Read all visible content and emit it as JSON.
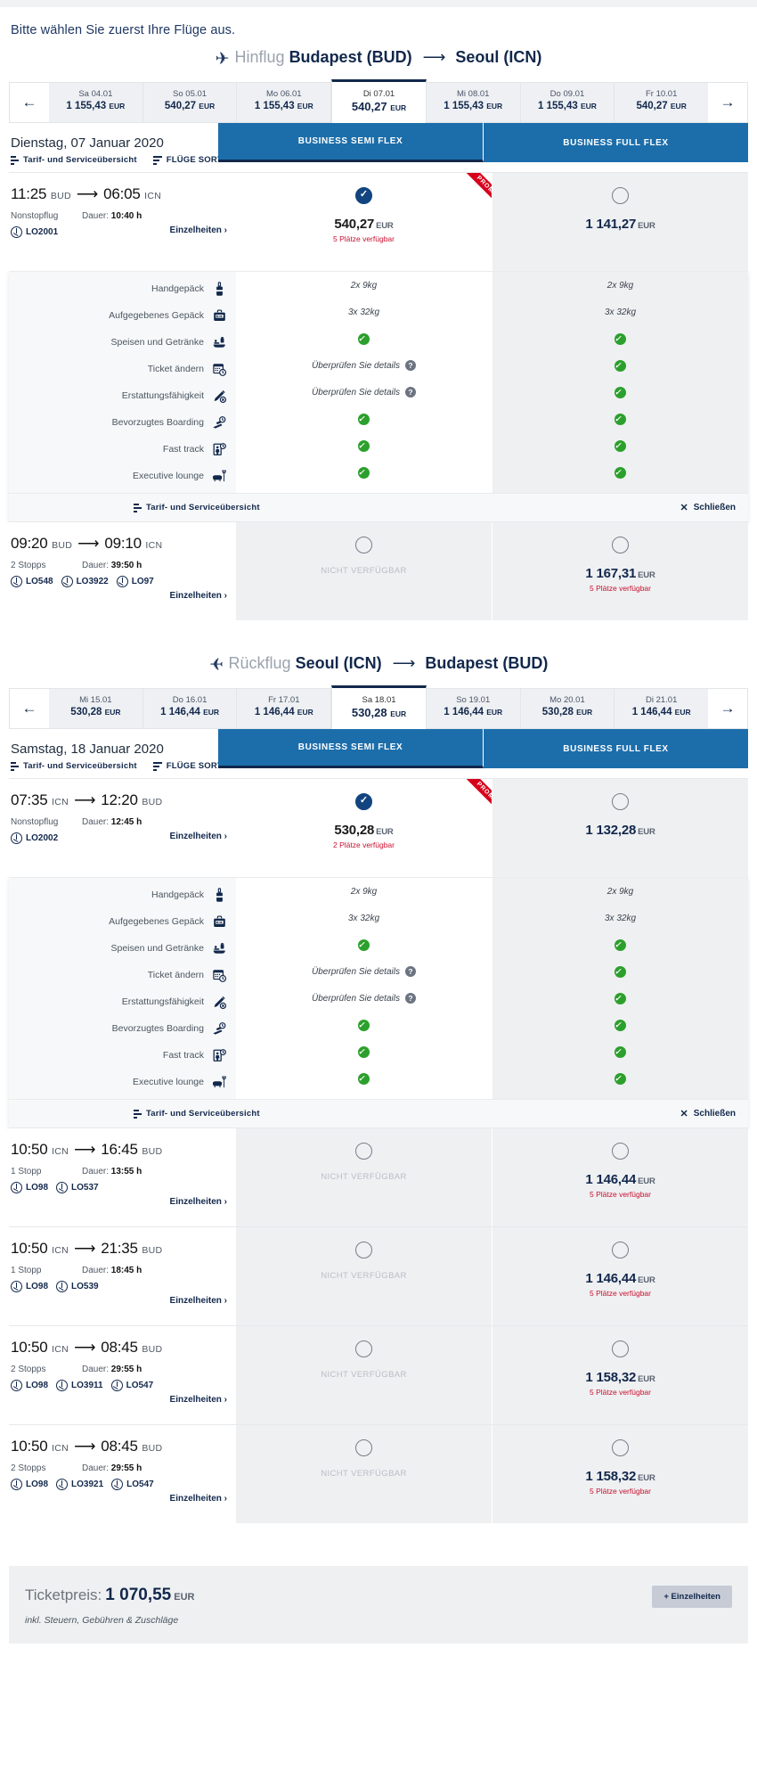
{
  "intro": "Bitte wählen Sie zuerst Ihre Flüge aus.",
  "outbound": {
    "label": "Hinflug",
    "from": "Budapest (BUD)",
    "to": "Seoul (ICN)",
    "arrow": "⟶",
    "datestrip": {
      "prev_icon": "arrow-left-icon",
      "next_icon": "arrow-right-icon",
      "days": [
        {
          "label": "Sa 04.01",
          "price": "1 155,43",
          "currency": "EUR",
          "active": false
        },
        {
          "label": "So 05.01",
          "price": "540,27",
          "currency": "EUR",
          "active": false
        },
        {
          "label": "Mo 06.01",
          "price": "1 155,43",
          "currency": "EUR",
          "active": false
        },
        {
          "label": "Di 07.01",
          "price": "540,27",
          "currency": "EUR",
          "active": true
        },
        {
          "label": "Mi 08.01",
          "price": "1 155,43",
          "currency": "EUR",
          "active": false
        },
        {
          "label": "Do 09.01",
          "price": "1 155,43",
          "currency": "EUR",
          "active": false
        },
        {
          "label": "Fr 10.01",
          "price": "540,27",
          "currency": "EUR",
          "active": false
        }
      ]
    },
    "day_title": "Dienstag, 07 Januar 2020",
    "tool_overview": "Tarif- und Serviceübersicht",
    "tool_sort": "FLÜGE SORTIEREN",
    "fares": [
      "BUSINESS SEMI FLEX",
      "BUSINESS FULL FLEX"
    ],
    "promo_label": "PROMO",
    "flights": [
      {
        "dep_time": "11:25",
        "dep_code": "BUD",
        "arr_time": "06:05",
        "arr_code": "ICN",
        "stops": "Nonstopflug",
        "duration_label": "Dauer:",
        "duration": "10:40 h",
        "carriers": [
          "LO2001"
        ],
        "details": "Einzelheiten",
        "cells": [
          {
            "state": "selected",
            "price": "540,27",
            "currency": "EUR",
            "seats": "5 Plätze verfügbar",
            "promo": true
          },
          {
            "state": "available",
            "price": "1 141,27",
            "currency": "EUR",
            "seats": "",
            "promo": false
          }
        ]
      },
      {
        "dep_time": "09:20",
        "dep_code": "BUD",
        "arr_time": "09:10",
        "arr_code": "ICN",
        "stops": "2 Stopps",
        "duration_label": "Dauer:",
        "duration": "39:50 h",
        "carriers": [
          "LO548",
          "LO3922",
          "LO97"
        ],
        "details": "Einzelheiten",
        "cells": [
          {
            "state": "unavailable",
            "unavailable_label": "NICHT VERFÜGBAR"
          },
          {
            "state": "available",
            "price": "1 167,31",
            "currency": "EUR",
            "seats": "5 Plätze verfügbar",
            "promo": false
          }
        ]
      }
    ]
  },
  "inbound": {
    "label": "Rückflug",
    "from": "Seoul (ICN)",
    "to": "Budapest (BUD)",
    "arrow": "⟶",
    "datestrip": {
      "days": [
        {
          "label": "Mi 15.01",
          "price": "530,28",
          "currency": "EUR",
          "active": false
        },
        {
          "label": "Do 16.01",
          "price": "1 146,44",
          "currency": "EUR",
          "active": false
        },
        {
          "label": "Fr 17.01",
          "price": "1 146,44",
          "currency": "EUR",
          "active": false
        },
        {
          "label": "Sa 18.01",
          "price": "530,28",
          "currency": "EUR",
          "active": true
        },
        {
          "label": "So 19.01",
          "price": "1 146,44",
          "currency": "EUR",
          "active": false
        },
        {
          "label": "Mo 20.01",
          "price": "530,28",
          "currency": "EUR",
          "active": false
        },
        {
          "label": "Di 21.01",
          "price": "1 146,44",
          "currency": "EUR",
          "active": false
        }
      ]
    },
    "day_title": "Samstag, 18 Januar 2020",
    "tool_overview": "Tarif- und Serviceübersicht",
    "tool_sort": "FLÜGE SORTIEREN",
    "fares": [
      "BUSINESS SEMI FLEX",
      "BUSINESS FULL FLEX"
    ],
    "promo_label": "PROMO",
    "flights": [
      {
        "dep_time": "07:35",
        "dep_code": "ICN",
        "arr_time": "12:20",
        "arr_code": "BUD",
        "stops": "Nonstopflug",
        "duration_label": "Dauer:",
        "duration": "12:45 h",
        "carriers": [
          "LO2002"
        ],
        "details": "Einzelheiten",
        "cells": [
          {
            "state": "selected",
            "price": "530,28",
            "currency": "EUR",
            "seats": "2 Plätze verfügbar",
            "promo": true
          },
          {
            "state": "available",
            "price": "1 132,28",
            "currency": "EUR",
            "seats": "",
            "promo": false
          }
        ]
      },
      {
        "dep_time": "10:50",
        "dep_code": "ICN",
        "arr_time": "16:45",
        "arr_code": "BUD",
        "stops": "1 Stopp",
        "duration_label": "Dauer:",
        "duration": "13:55 h",
        "carriers": [
          "LO98",
          "LO537"
        ],
        "details": "Einzelheiten",
        "cells": [
          {
            "state": "unavailable",
            "unavailable_label": "NICHT VERFÜGBAR"
          },
          {
            "state": "available",
            "price": "1 146,44",
            "currency": "EUR",
            "seats": "5 Plätze verfügbar",
            "promo": false
          }
        ]
      },
      {
        "dep_time": "10:50",
        "dep_code": "ICN",
        "arr_time": "21:35",
        "arr_code": "BUD",
        "stops": "1 Stopp",
        "duration_label": "Dauer:",
        "duration": "18:45 h",
        "carriers": [
          "LO98",
          "LO539"
        ],
        "details": "Einzelheiten",
        "cells": [
          {
            "state": "unavailable",
            "unavailable_label": "NICHT VERFÜGBAR"
          },
          {
            "state": "available",
            "price": "1 146,44",
            "currency": "EUR",
            "seats": "5 Plätze verfügbar",
            "promo": false
          }
        ]
      },
      {
        "dep_time": "10:50",
        "dep_code": "ICN",
        "arr_time": "08:45",
        "arr_code": "BUD",
        "stops": "2 Stopps",
        "duration_label": "Dauer:",
        "duration": "29:55 h",
        "carriers": [
          "LO98",
          "LO3911",
          "LO547"
        ],
        "details": "Einzelheiten",
        "cells": [
          {
            "state": "unavailable",
            "unavailable_label": "NICHT VERFÜGBAR"
          },
          {
            "state": "available",
            "price": "1 158,32",
            "currency": "EUR",
            "seats": "5 Plätze verfügbar",
            "promo": false
          }
        ]
      },
      {
        "dep_time": "10:50",
        "dep_code": "ICN",
        "arr_time": "08:45",
        "arr_code": "BUD",
        "stops": "2 Stopps",
        "duration_label": "Dauer:",
        "duration": "29:55 h",
        "carriers": [
          "LO98",
          "LO3921",
          "LO547"
        ],
        "details": "Einzelheiten",
        "cells": [
          {
            "state": "unavailable",
            "unavailable_label": "NICHT VERFÜGBAR"
          },
          {
            "state": "available",
            "price": "1 158,32",
            "currency": "EUR",
            "seats": "5 Plätze verfügbar",
            "promo": false
          }
        ]
      }
    ]
  },
  "amenities": {
    "rows": [
      {
        "label": "Handgepäck",
        "icon": "carry-on-bag-icon",
        "semi": "2x 9kg",
        "full": "2x 9kg",
        "semi_type": "text",
        "full_type": "text"
      },
      {
        "label": "Aufgegebenes Gepäck",
        "icon": "checked-baggage-icon",
        "semi": "3x 32kg",
        "full": "3x 32kg",
        "semi_type": "text",
        "full_type": "text"
      },
      {
        "label": "Speisen und Getränke",
        "icon": "meal-icon",
        "semi": "",
        "full": "",
        "semi_type": "tick",
        "full_type": "tick"
      },
      {
        "label": "Ticket ändern",
        "icon": "change-ticket-icon",
        "semi": "Überprüfen Sie details",
        "full": "",
        "semi_type": "info",
        "full_type": "tick"
      },
      {
        "label": "Erstattungsfähigkeit",
        "icon": "refund-icon",
        "semi": "Überprüfen Sie details",
        "full": "",
        "semi_type": "info",
        "full_type": "tick"
      },
      {
        "label": "Bevorzugtes Boarding",
        "icon": "priority-boarding-icon",
        "semi": "",
        "full": "",
        "semi_type": "tick",
        "full_type": "tick"
      },
      {
        "label": "Fast track",
        "icon": "fast-track-icon",
        "semi": "",
        "full": "",
        "semi_type": "tick",
        "full_type": "tick"
      },
      {
        "label": "Executive lounge",
        "icon": "lounge-icon",
        "semi": "",
        "full": "",
        "semi_type": "tick",
        "full_type": "tick"
      }
    ],
    "footer_overview": "Tarif- und Serviceübersicht",
    "footer_close": "Schließen"
  },
  "total": {
    "label": "Ticketpreis:",
    "amount": "1 070,55",
    "currency": "EUR",
    "note": "inkl. Steuern, Gebühren & Zuschläge",
    "details_button": "+ Einzelheiten"
  },
  "colors": {
    "brand_navy": "#12284c",
    "fare_header_blue": "#1c6eab",
    "promo_red": "#d6001c",
    "seats_red": "#c8102e",
    "tick_green": "#2ca02c"
  }
}
